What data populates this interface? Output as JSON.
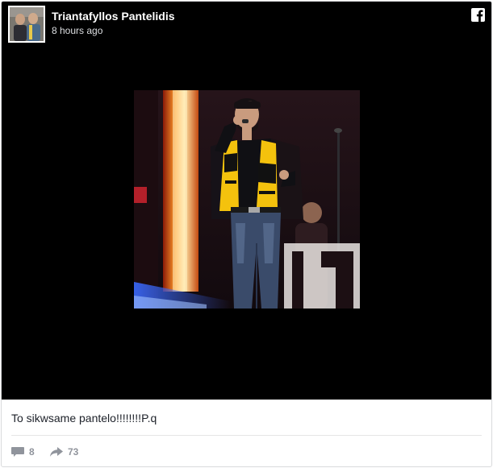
{
  "post": {
    "author": "Triantafyllos Pantelidis",
    "timestamp": "8 hours ago",
    "caption": "To sikwsame pantelo!!!!!!!!P.q",
    "comments_count": "8",
    "shares_count": "73"
  },
  "icons": {
    "brand": "facebook-icon",
    "comments": "comment-icon",
    "shares": "share-arrow-icon"
  },
  "colors": {
    "media_background": "#000000",
    "author_text": "#ffffff",
    "meta_text": "#90949c",
    "caption_text": "#1d2129",
    "scarf_yellow": "#f4c20d"
  }
}
